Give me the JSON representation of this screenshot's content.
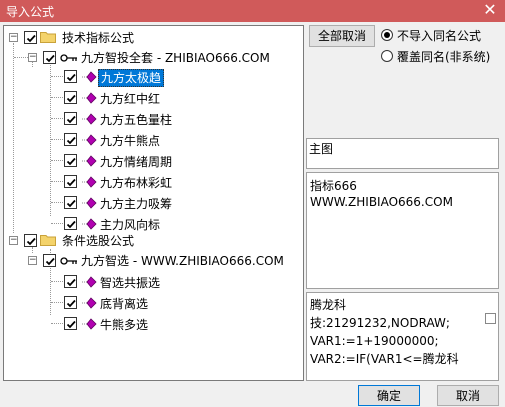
{
  "window": {
    "title": "导入公式",
    "close_glyph": "✕"
  },
  "tree": {
    "nodes": [
      {
        "label": "技术指标公式"
      },
      {
        "label": "九方智投全套 - ZHIBIAO666.COM"
      },
      {
        "label": "九方太极趋"
      },
      {
        "label": "九方红中红"
      },
      {
        "label": "九方五色量柱"
      },
      {
        "label": "九方牛熊点"
      },
      {
        "label": "九方情绪周期"
      },
      {
        "label": "九方布林彩虹"
      },
      {
        "label": "九方主力吸筹"
      },
      {
        "label": "主力风向标"
      },
      {
        "label": "条件选股公式"
      },
      {
        "label": "九方智选 - WWW.ZHIBIAO666.COM"
      },
      {
        "label": "智选共振选"
      },
      {
        "label": "底背离选"
      },
      {
        "label": "牛熊多选"
      }
    ]
  },
  "options": {
    "deselect_all": "全部取消",
    "no_import_same": "不导入同名公式",
    "overwrite_same": "覆盖同名(非系统)"
  },
  "main_chart": {
    "label": "主图"
  },
  "description": {
    "line1": "指标666",
    "line2": "WWW.ZHIBIAO666.COM"
  },
  "code": {
    "line1": "腾龙科",
    "line2": "技:21291232,NODRAW;",
    "line3": "VAR1:=1+19000000;",
    "line4": "VAR2:=IF(VAR1<=腾龙科"
  },
  "buttons": {
    "ok": "确定",
    "cancel": "取消"
  },
  "colors": {
    "title_bar": "#d05a5a",
    "selection": "#0078d7",
    "gem": "#b000b0"
  }
}
